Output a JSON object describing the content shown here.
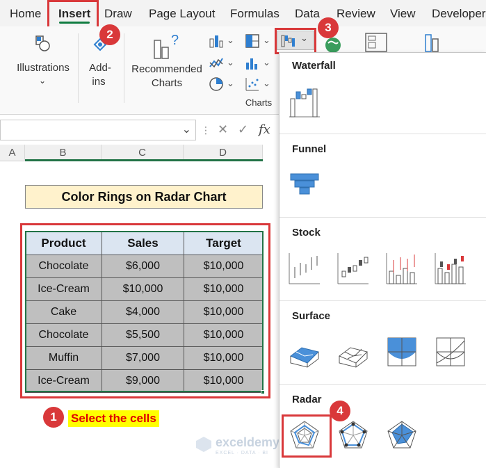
{
  "tabs": [
    "Home",
    "Insert",
    "Draw",
    "Page Layout",
    "Formulas",
    "Data",
    "Review",
    "View",
    "Developer"
  ],
  "ribbon": {
    "illustrations": "Illustrations",
    "addins_line1": "Add-",
    "addins_line2": "ins",
    "recommended_line1": "Recommended",
    "recommended_line2": "Charts",
    "charts_group": "Charts"
  },
  "formula_bar": {
    "fx": "fx"
  },
  "columns": [
    "A",
    "B",
    "C",
    "D"
  ],
  "sheet": {
    "title": "Color Rings on Radar Chart",
    "headers": [
      "Product",
      "Sales",
      "Target"
    ],
    "rows": [
      [
        "Chocolate",
        "$6,000",
        "$10,000"
      ],
      [
        "Ice-Cream",
        "$10,000",
        "$10,000"
      ],
      [
        "Cake",
        "$4,000",
        "$10,000"
      ],
      [
        "Chocolate",
        "$5,500",
        "$10,000"
      ],
      [
        "Muffin",
        "$7,000",
        "$10,000"
      ],
      [
        "Ice-Cream",
        "$9,000",
        "$10,000"
      ]
    ]
  },
  "steps": [
    "1",
    "2",
    "3",
    "4"
  ],
  "callout": "Select the cells",
  "panel": {
    "sections": [
      "Waterfall",
      "Funnel",
      "Stock",
      "Surface",
      "Radar"
    ]
  },
  "watermark": {
    "main": "exceldemy",
    "sub": "EXCEL · DATA · BI"
  },
  "colors": {
    "accent_red": "#d9383a",
    "excel_green": "#217346",
    "title_fill": "#fff2cc",
    "header_fill": "#dbe5f1",
    "cell_fill": "#bfbfbf",
    "chart_blue": "#4a90d9"
  }
}
